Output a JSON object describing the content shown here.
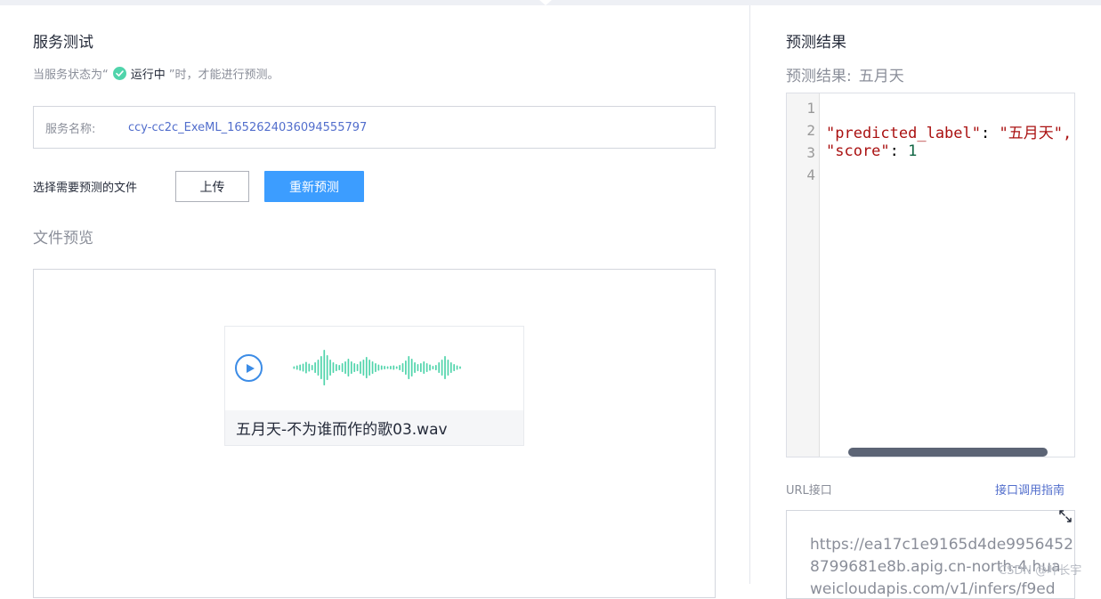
{
  "left": {
    "title": "服务测试",
    "hint_prefix": "当服务状态为“",
    "hint_status": "运行中",
    "hint_suffix": "”时，才能进行预测。",
    "service_label": "服务名称:",
    "service_name": "ccy-cc2c_ExeML_1652624036094555797",
    "select_label": "选择需要预测的文件",
    "upload_label": "上传",
    "repredict_label": "重新预测",
    "preview_title": "文件预览",
    "audio_filename": "五月天-不为谁而作的歌03.wav"
  },
  "right": {
    "title": "预测结果",
    "result_label": "预测结果:",
    "result_value": "五月天",
    "code": {
      "line_numbers": [
        "1",
        "2",
        "3",
        "4"
      ],
      "key1": "\"predicted_label\"",
      "sep1": ": ",
      "val1": "\"五月天\",",
      "key2": "\"score\"",
      "sep2": ": ",
      "val2": "1"
    },
    "url_label": "URL接口",
    "url_guide": "接口调用指南",
    "url_line1": "https://ea17c1e9165d4de9956452",
    "url_line2": "8799681e8b.apig.cn-north-4.hua",
    "url_line3": "weicloudapis.com/v1/infers/f9ed"
  },
  "watermark": "CSDN @叶长宇",
  "colors": {
    "primary": "#3c9dff",
    "link": "#526ecc",
    "success": "#50d4ab",
    "wave": "#50d4ab"
  },
  "icons": {
    "status": "check-circle-icon",
    "play": "play-icon",
    "expand": "expand-icon"
  }
}
